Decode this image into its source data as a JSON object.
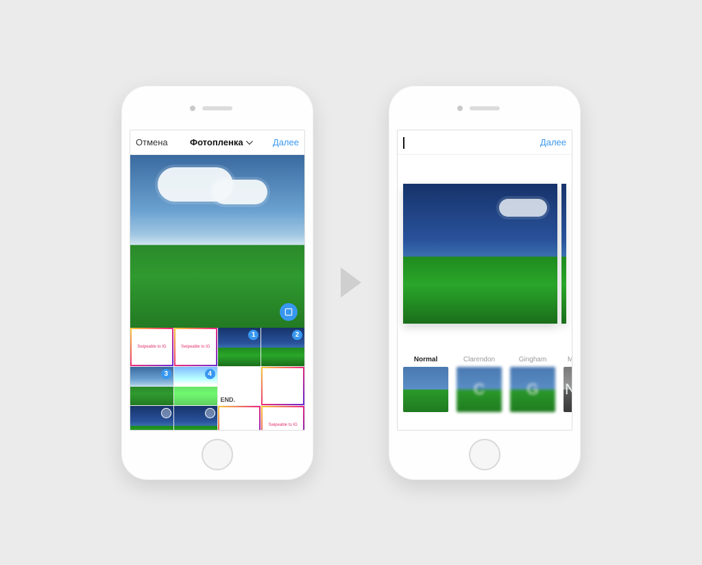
{
  "accent": "#3897f0",
  "screen1": {
    "nav": {
      "cancel": "Отмена",
      "title": "Фотопленка",
      "next": "Далее"
    },
    "selected_badges": [
      "1",
      "2",
      "3",
      "4"
    ],
    "thumbs": {
      "swipeable1": "Swipeable to IG",
      "swipeable2": "Swipeable to IG",
      "end": "END."
    }
  },
  "screen2": {
    "nav": {
      "next": "Далее"
    },
    "filters": [
      {
        "name": "Normal",
        "letter": "",
        "active": true,
        "style": "normal"
      },
      {
        "name": "Clarendon",
        "letter": "C",
        "active": false,
        "style": "blur"
      },
      {
        "name": "Gingham",
        "letter": "G",
        "active": false,
        "style": "blur"
      },
      {
        "name": "M",
        "letter": "N",
        "active": false,
        "style": "gray",
        "cut": true
      }
    ]
  }
}
